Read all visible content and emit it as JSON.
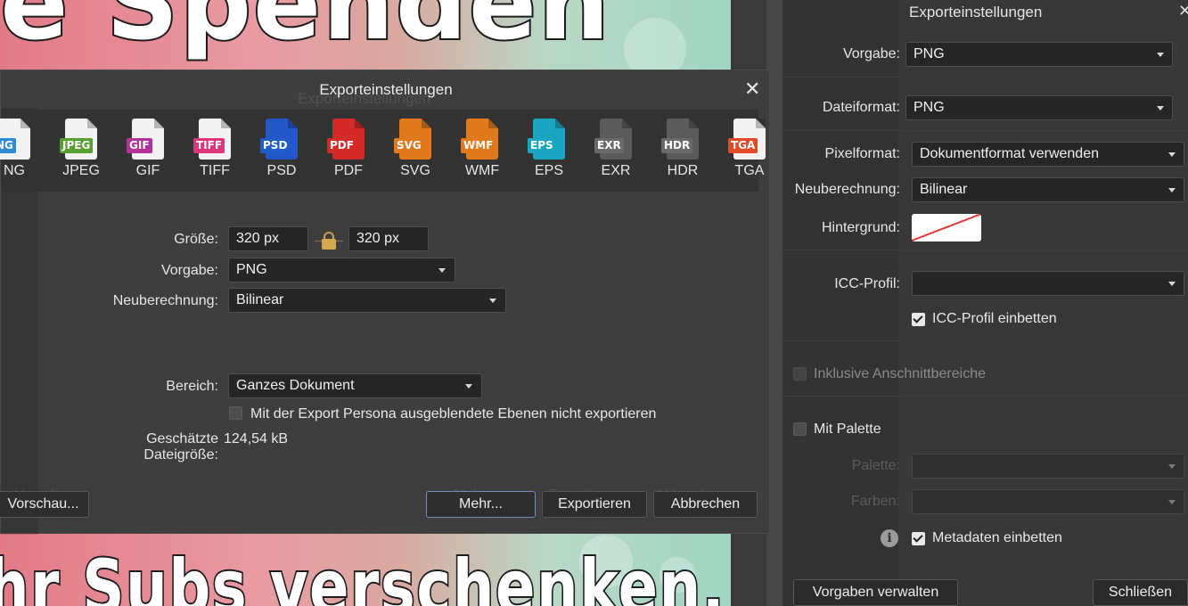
{
  "canvas": {
    "title_top": "ie Spenden",
    "title_bottom": "Ihr Subs verschenken."
  },
  "side_panel": {
    "title": "Exporteinstellungen",
    "close_icon": "close-icon",
    "vorgabe": {
      "label": "Vorgabe:",
      "value": "PNG"
    },
    "dateiformat": {
      "label": "Dateiformat:",
      "value": "PNG"
    },
    "pixelformat": {
      "label": "Pixelformat:",
      "value": "Dokumentformat verwenden"
    },
    "neuberechnung": {
      "label": "Neuberechnung:",
      "value": "Bilinear"
    },
    "hintergrund": {
      "label": "Hintergrund:"
    },
    "icc_profil": {
      "label": "ICC-Profil:",
      "value": ""
    },
    "icc_einbetten": {
      "label": "ICC-Profil einbetten",
      "checked": true
    },
    "anschnitt": {
      "label": "Inklusive Anschnittbereiche",
      "checked": false
    },
    "mit_palette": {
      "label": "Mit Palette",
      "checked": false
    },
    "palette": {
      "label": "Palette:",
      "value": ""
    },
    "farben": {
      "label": "Farben:",
      "value": ""
    },
    "metadaten": {
      "label": "Metadaten einbetten",
      "checked": true
    },
    "vorgaben_button": "Vorgaben verwalten",
    "schliessen_button": "Schließen"
  },
  "dialog": {
    "title": "Exporteinstellungen",
    "title_ghost": "Exporteinstellungen",
    "formats": [
      {
        "label": "NG",
        "tag": "NG",
        "color": "#2e8bd6"
      },
      {
        "label": "JPEG",
        "tag": "JPEG",
        "color": "#58a032"
      },
      {
        "label": "GIF",
        "tag": "GIF",
        "color": "#b2339a"
      },
      {
        "label": "TIFF",
        "tag": "TIFF",
        "color": "#e0357a"
      },
      {
        "label": "PSD",
        "tag": "PSD",
        "color": "#1f5ec9"
      },
      {
        "label": "PDF",
        "tag": "PDF",
        "color": "#d42a2a"
      },
      {
        "label": "SVG",
        "tag": "SVG",
        "color": "#e07a1c"
      },
      {
        "label": "WMF",
        "tag": "WMF",
        "color": "#e0791c"
      },
      {
        "label": "EPS",
        "tag": "EPS",
        "color": "#1aa6c0"
      },
      {
        "label": "EXR",
        "tag": "EXR",
        "color": "#6a6a6a"
      },
      {
        "label": "HDR",
        "tag": "HDR",
        "color": "#6a6a6a"
      },
      {
        "label": "TGA",
        "tag": "TGA",
        "color": "#e04a24"
      }
    ],
    "groesse": {
      "label": "Größe:",
      "width": "320 px",
      "height": "320 px"
    },
    "vorgabe": {
      "label": "Vorgabe:",
      "value": "PNG"
    },
    "neuberechnung": {
      "label": "Neuberechnung:",
      "value": "Bilinear"
    },
    "bereich": {
      "label": "Bereich:",
      "value": "Ganzes Dokument"
    },
    "ausgeblendet": {
      "label": "Mit der Export Persona ausgeblendete Ebenen nicht exportieren",
      "checked": false
    },
    "dateigroesse": {
      "label": "Geschätzte Dateigröße:",
      "value": "124,54 kB"
    },
    "buttons": {
      "vorschau": "Vorschau...",
      "mehr": "Mehr...",
      "exportieren": "Exportieren",
      "abbrechen": "Abbrechen"
    },
    "ghost": {
      "vorschau": "Vorschau...",
      "mehr": "Mehr...",
      "exportieren": "Exportieren",
      "abbrechen": "Abbrechen"
    }
  }
}
